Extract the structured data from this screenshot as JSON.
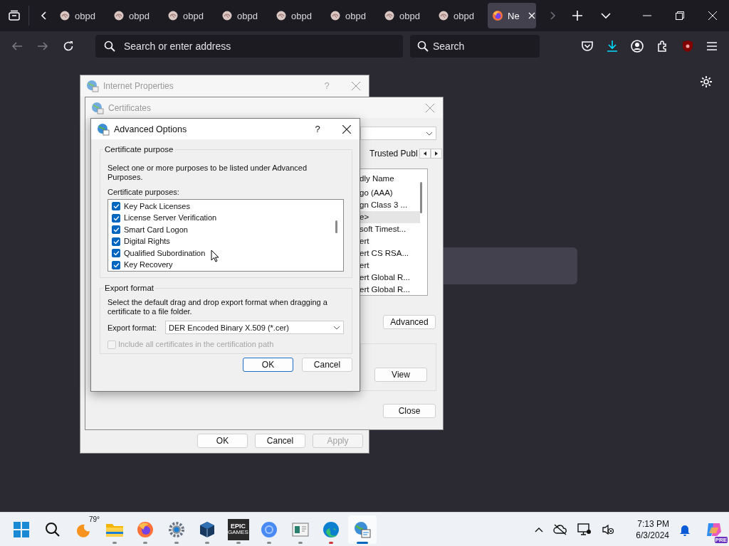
{
  "browser": {
    "tabs": [
      {
        "label": "obpd",
        "selected": false
      },
      {
        "label": "obpd",
        "selected": false
      },
      {
        "label": "obpd",
        "selected": false
      },
      {
        "label": "obpd",
        "selected": false
      },
      {
        "label": "obpd",
        "selected": false
      },
      {
        "label": "obpd",
        "selected": false
      },
      {
        "label": "obpd",
        "selected": false
      },
      {
        "label": "obpd",
        "selected": false
      },
      {
        "label": "Ne",
        "selected": true
      }
    ],
    "address": {
      "placeholder": "Search or enter address"
    },
    "search": {
      "placeholder": "Search"
    }
  },
  "windows": {
    "internet_properties": {
      "title": "Internet Properties",
      "help": "?",
      "buttons": [
        {
          "label": "OK",
          "disabled": false
        },
        {
          "label": "Cancel",
          "disabled": false
        },
        {
          "label": "Apply",
          "disabled": true
        }
      ]
    },
    "certificates": {
      "title": "Certificates",
      "tab": "Trusted Publ",
      "list": {
        "header": "dly Name",
        "rows": [
          {
            "text": "go (AAA)",
            "selected": false
          },
          {
            "text": "gn Class 3 ...",
            "selected": false
          },
          {
            "text": "e>",
            "selected": true
          },
          {
            "text": "soft Timest...",
            "selected": false
          },
          {
            "text": "ert",
            "selected": false
          },
          {
            "text": "ert CS RSA...",
            "selected": false
          },
          {
            "text": "ert",
            "selected": false
          },
          {
            "text": "ert Global R...",
            "selected": false
          },
          {
            "text": "ert Global R...",
            "selected": false
          }
        ]
      },
      "advanced": "Advanced",
      "view": "View",
      "close": "Close"
    },
    "advanced_options": {
      "title": "Advanced Options",
      "help": "?",
      "purpose_group": "Certificate purpose",
      "instructions": "Select one or more purposes to be listed under Advanced Purposes.",
      "purposes_label": "Certificate purposes:",
      "purposes": [
        {
          "label": "Key Pack Licenses",
          "checked": true
        },
        {
          "label": "License Server Verification",
          "checked": true
        },
        {
          "label": "Smart Card Logon",
          "checked": true
        },
        {
          "label": "Digital Rights",
          "checked": true
        },
        {
          "label": "Qualified Subordination",
          "checked": true
        },
        {
          "label": "Key Recovery",
          "checked": true
        }
      ],
      "export_group": "Export format",
      "export_text": "Select the default drag and drop export format when dragging a certificate to a file folder.",
      "export_label": "Export format:",
      "export_value": "DER Encoded Binary X.509 (*.cer)",
      "include_all": {
        "label": "Include all certificates in the certification path",
        "checked": false,
        "disabled": true
      },
      "ok": "OK",
      "cancel": "Cancel"
    }
  },
  "taskbar": {
    "weather": "79°",
    "epic": [
      "EPIC",
      "GAMES"
    ],
    "apps": [
      {
        "running": false,
        "active": false,
        "attention": false
      },
      {
        "running": false,
        "active": false,
        "attention": false
      },
      {
        "running": false,
        "active": false,
        "attention": false
      },
      {
        "running": true,
        "active": false,
        "attention": false
      },
      {
        "running": true,
        "active": false,
        "attention": false
      },
      {
        "running": true,
        "active": false,
        "attention": false
      },
      {
        "running": true,
        "active": false,
        "attention": false
      },
      {
        "running": true,
        "active": false,
        "attention": false
      },
      {
        "running": true,
        "active": false,
        "attention": false
      },
      {
        "running": true,
        "active": false,
        "attention": false
      },
      {
        "running": true,
        "active": false,
        "attention": true
      },
      {
        "running": true,
        "active": true,
        "attention": false
      }
    ],
    "clock": {
      "time": "7:13 PM",
      "date": "6/3/2024"
    },
    "copilot_badge": "PRE"
  }
}
